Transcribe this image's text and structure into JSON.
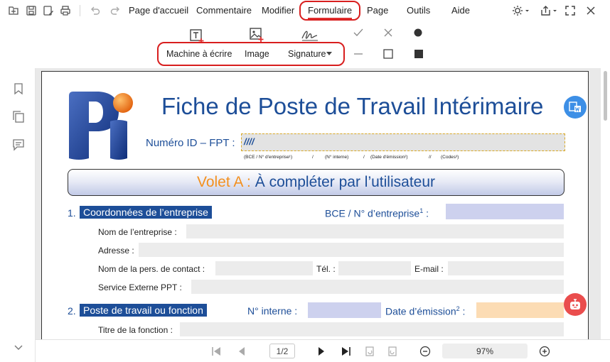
{
  "menu": {
    "items": [
      {
        "label": "Page d'accueil"
      },
      {
        "label": "Commentaire"
      },
      {
        "label": "Modifier"
      },
      {
        "label": "Formulaire"
      },
      {
        "label": "Page"
      },
      {
        "label": "Outils"
      },
      {
        "label": "Aide"
      }
    ],
    "active": "Formulaire"
  },
  "form_toolbar": {
    "typewriter_label": "Machine à écrire",
    "image_label": "Image",
    "signature_label": "Signature"
  },
  "document": {
    "logo_text": "Pi",
    "title": "Fiche de Poste de Travail Intérimaire",
    "id_label": "Numéro ID – FPT :",
    "id_value": "////",
    "id_notes": {
      "bce": "(BCE / N° d'entreprise¹)",
      "sep1": "/",
      "internal": "(N° interne)",
      "sep2": "/",
      "emission": "(Date d'émission²)",
      "sep3": "//",
      "codes": "(Codes³)"
    },
    "banner_part_a": "Volet A :",
    "banner_part_b": "À compléter par l’utilisateur",
    "section1": {
      "number": "1.",
      "title": "Coordonnées de l’entreprise",
      "bce_label": "BCE / N° d’entreprise",
      "bce_sup": "1",
      "bce_colon": " :",
      "company_name_label": "Nom de l’entreprise :",
      "address_label": "Adresse :",
      "contact_label": "Nom de la pers. de contact :",
      "phone_label": "Tél. :",
      "email_label": "E-mail :",
      "ppt_label": "Service Externe PPT :"
    },
    "section2": {
      "number": "2.",
      "title": "Poste de travail ou fonction",
      "internal_label": "N° interne :",
      "emission_label": "Date d’émission",
      "emission_sup": "2",
      "emission_colon": " :",
      "function_label": "Titre de la fonction :"
    }
  },
  "pagination": {
    "current": "1",
    "separator": "/",
    "total": "2",
    "zoom": "97%"
  },
  "colors": {
    "accent": "#d81e1e",
    "doc_blue": "#1d4e98",
    "doc_orange": "#f3901f",
    "field_gray": "#ececec",
    "field_lavender": "#cdd1ee",
    "field_peach": "#fcdcb4"
  },
  "icons": [
    "save-icon",
    "save-as-icon",
    "edit-icon",
    "print-icon",
    "undo-icon",
    "redo-icon",
    "theme-icon",
    "share-icon",
    "fullscreen-icon",
    "close-icon",
    "bookmark-icon",
    "pages-icon",
    "comment-icon",
    "convert-word-icon",
    "ai-assistant-icon"
  ]
}
